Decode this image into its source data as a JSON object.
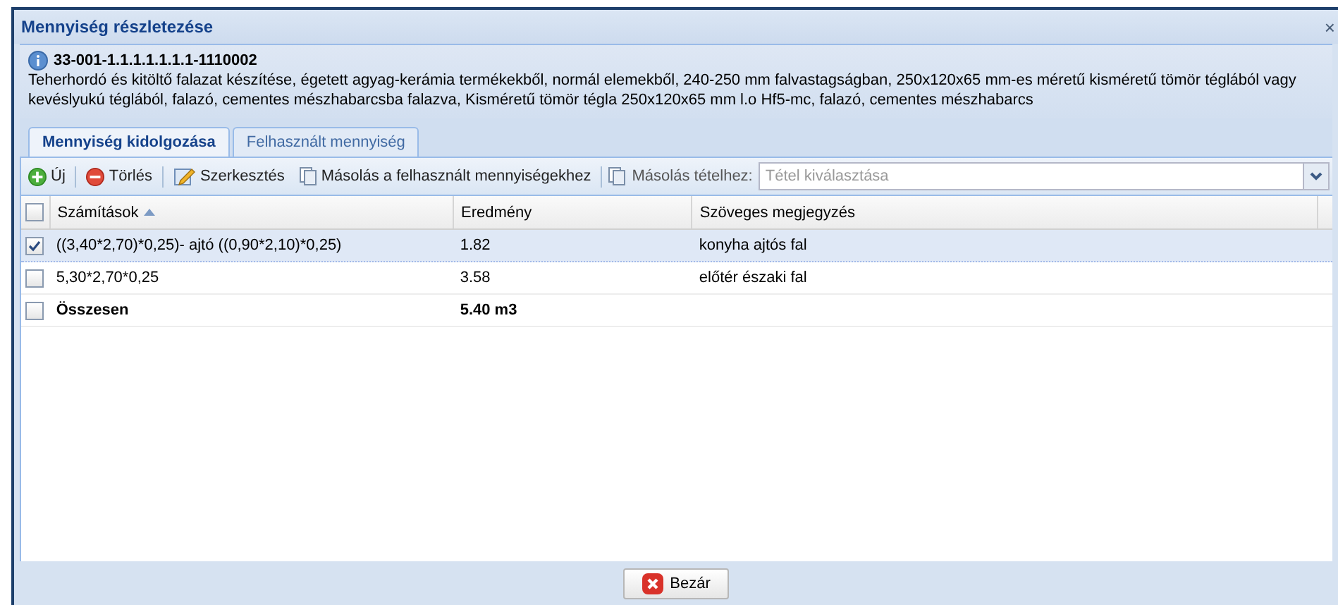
{
  "window": {
    "title": "Mennyiség részletezése",
    "close": "×"
  },
  "info": {
    "code": "33-001-1.1.1.1.1.1.1-1110002",
    "description": "Teherhordó és kitöltő falazat készítése, égetett agyag-kerámia termékekből, normál elemekből, 240-250 mm falvastagságban, 250x120x65 mm-es méretű kisméretű tömör téglából vagy kevéslyukú téglából, falazó, cementes mészhabarcsba falazva, Kisméretű tömör tégla 250x120x65 mm l.o Hf5-mc, falazó, cementes mészhabarcs"
  },
  "tabs": [
    {
      "label": "Mennyiség kidolgozása",
      "selected": true
    },
    {
      "label": "Felhasznált mennyiség",
      "selected": false
    }
  ],
  "toolbar": [
    {
      "kind": "add",
      "label": "Új"
    },
    {
      "kind": "delete",
      "label": "Törlés"
    },
    {
      "kind": "edit",
      "label": "Szerkesztés"
    },
    {
      "kind": "copy",
      "label": "Másolás a felhasznált mennyiségekhez"
    }
  ],
  "copy_to_item": {
    "label": "Másolás tételhez:",
    "placeholder": "Tétel kiválasztása"
  },
  "table": {
    "all_checked": false,
    "columns": [
      {
        "label": "Számítások",
        "sorted": true
      },
      {
        "label": "Eredmény",
        "sorted": false
      },
      {
        "label": "Szöveges megjegyzés",
        "sorted": false
      }
    ],
    "rows": [
      {
        "checked": true,
        "selected": true,
        "bold": false,
        "cells": [
          "((3,40*2,70)*0,25)- ajtó ((0,90*2,10)*0,25)",
          "1.82",
          "konyha ajtós fal"
        ]
      },
      {
        "checked": false,
        "selected": false,
        "bold": false,
        "cells": [
          "5,30*2,70*0,25",
          "3.58",
          "előtér északi fal"
        ]
      },
      {
        "checked": false,
        "selected": false,
        "bold": true,
        "cells": [
          "Összesen",
          "5.40 m3"
        ]
      }
    ]
  },
  "close_button": "Bezár"
}
